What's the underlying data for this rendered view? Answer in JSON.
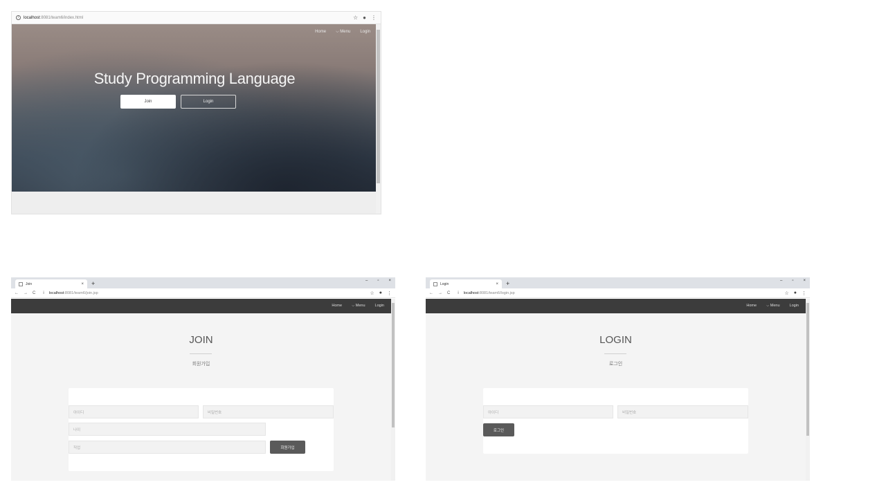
{
  "index_window": {
    "url_host": "localhost",
    "url_path": ":8081/team6/index.html",
    "nav": [
      "Home",
      "⌵ Menu",
      "Login"
    ],
    "hero_title": "Study Programming Language",
    "join_button": "Join",
    "login_button": "Login"
  },
  "join_window": {
    "tab_title": "Join",
    "tab_close": "×",
    "new_tab": "+",
    "url_host": "localhost",
    "url_path": ":8081/team6/join.jsp",
    "nav": [
      "Home",
      "⌵ Menu",
      "Login"
    ],
    "title": "JOIN",
    "subtitle": "회원가입",
    "id_placeholder": "아이디",
    "password_placeholder": "비밀번호",
    "age_placeholder": "나이",
    "job_placeholder": "직업",
    "submit_label": "회원가입"
  },
  "login_window": {
    "tab_title": "Login",
    "tab_close": "×",
    "new_tab": "+",
    "url_host": "localhost",
    "url_path": ":8081/team6/login.jsp",
    "nav": [
      "Home",
      "⌵ Menu",
      "Login"
    ],
    "title": "LOGIN",
    "subtitle": "로그인",
    "id_placeholder": "아이디",
    "password_placeholder": "비밀번호",
    "submit_label": "로그인"
  },
  "browser_controls": {
    "minimize": "–",
    "restore": "▫",
    "close": "×",
    "back": "←",
    "forward": "→",
    "reload": "C",
    "info": "i",
    "star": "☆",
    "account": "●",
    "kebab": "⋮"
  }
}
